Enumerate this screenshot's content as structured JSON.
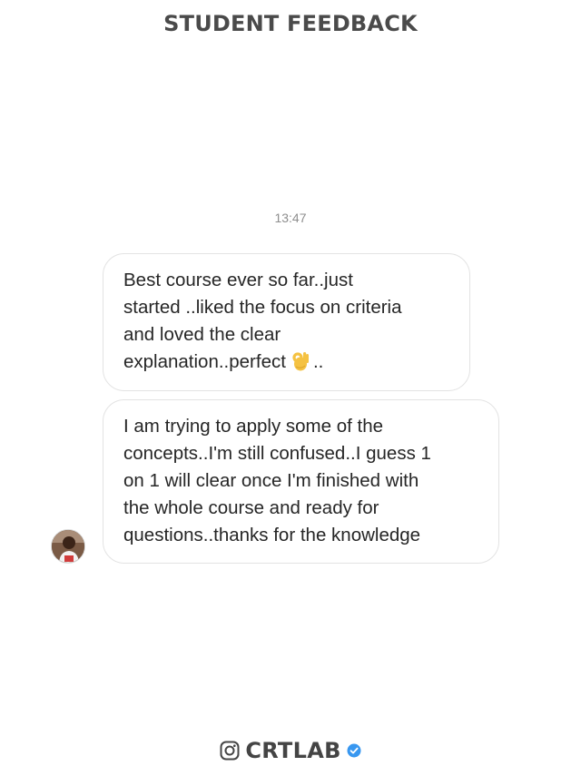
{
  "header": {
    "title": "STUDENT FEEDBACK"
  },
  "conversation": {
    "timestamp": "13:47",
    "messages": [
      {
        "lines": [
          "Best course ever so far..just",
          "started ..liked the focus on criteria",
          "and loved the clear",
          "explanation..perfect"
        ],
        "trailing_emoji": "ok-hand",
        "trailing_text": ".."
      },
      {
        "lines": [
          "I am trying to apply some of the",
          "concepts..I'm still confused..I guess 1",
          "on 1 will clear once I'm finished with",
          "the whole course and ready for",
          "questions..thanks for the knowledge"
        ]
      }
    ]
  },
  "footer": {
    "brand": "CRTLAB",
    "icons": [
      "instagram-icon",
      "verified-badge-icon"
    ],
    "colors": {
      "verified": "#3897f0",
      "brand_text": "#444444"
    }
  }
}
